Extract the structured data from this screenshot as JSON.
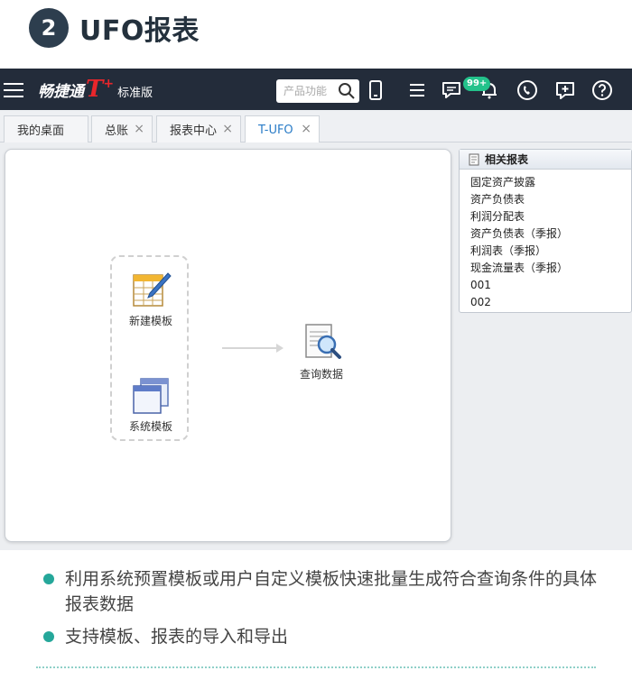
{
  "section": {
    "number": "2",
    "title": "UFO报表"
  },
  "app": {
    "brand_name": "畅捷通",
    "brand_t": "T",
    "brand_plus": "+",
    "edition": "标准版",
    "search_placeholder": "产品功能",
    "notification_badge": "99+",
    "icons": [
      "menu-icon",
      "search-icon",
      "mobile-icon",
      "chat-icon",
      "list-icon",
      "bell-icon",
      "phone-icon",
      "message-icon",
      "help-icon"
    ]
  },
  "tabs": [
    {
      "label": "我的桌面",
      "closable": false,
      "active": false
    },
    {
      "label": "总账",
      "closable": true,
      "active": false
    },
    {
      "label": "报表中心",
      "closable": true,
      "active": false
    },
    {
      "label": "T-UFO",
      "closable": true,
      "active": true
    }
  ],
  "workflow": {
    "new_template": "新建模板",
    "system_template": "系统模板",
    "query_data": "查询数据"
  },
  "related": {
    "title": "相关报表",
    "items": [
      "固定资产披露",
      "资产负债表",
      "利润分配表",
      "资产负债表（季报）",
      "利润表（季报）",
      "现金流量表（季报）",
      "001",
      "002"
    ]
  },
  "bullets": [
    "利用系统预置模板或用户自定义模板快速批量生成符合查询条件的具体报表数据",
    "支持模板、报表的导入和导出"
  ],
  "colors": {
    "accent": "#25a79a",
    "topbar": "#232c3a",
    "brand_red": "#e8262b",
    "tab_active": "#2a7cc7",
    "badge": "#23c28b"
  }
}
